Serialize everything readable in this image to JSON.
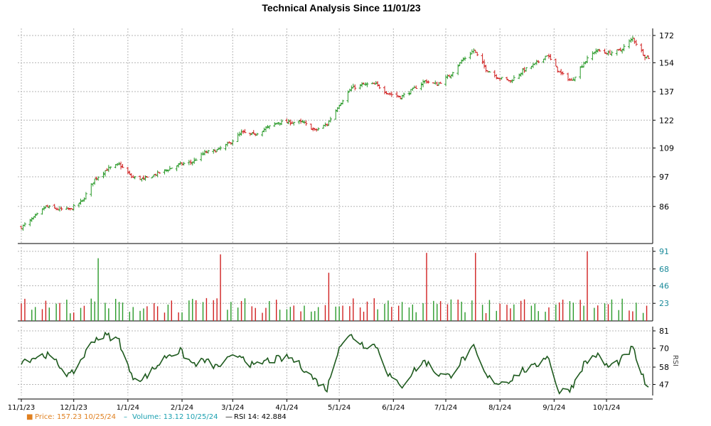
{
  "chart_data": {
    "type": "ohlc-volume-rsi",
    "title": "Technical Analysis Since 11/01/23",
    "x_dates": [
      "11/1/23",
      "12/1/23",
      "1/1/24",
      "2/1/24",
      "3/1/24",
      "4/1/24",
      "5/1/24",
      "6/1/24",
      "7/1/24",
      "8/1/24",
      "9/1/24",
      "10/1/24"
    ],
    "x_range": [
      "11/1/23",
      "10/25/24"
    ],
    "price": {
      "ticks": [
        "172",
        "154",
        "137",
        "122",
        "109",
        "97",
        "86"
      ],
      "ylim": [
        74,
        177
      ],
      "scale": "log",
      "closes_weekly": [
        [
          "11/1/23",
          79
        ],
        [
          "11/8/23",
          82
        ],
        [
          "11/15/23",
          86
        ],
        [
          "11/22/23",
          85
        ],
        [
          "11/29/23",
          85
        ],
        [
          "12/6/23",
          88
        ],
        [
          "12/13/23",
          96
        ],
        [
          "12/20/23",
          100
        ],
        [
          "12/27/23",
          102
        ],
        [
          "1/3/24",
          97
        ],
        [
          "1/10/24",
          96
        ],
        [
          "1/17/24",
          98
        ],
        [
          "1/24/24",
          100
        ],
        [
          "1/31/24",
          102
        ],
        [
          "2/7/24",
          103
        ],
        [
          "2/14/24",
          107
        ],
        [
          "2/21/24",
          108
        ],
        [
          "2/28/24",
          111
        ],
        [
          "3/6/24",
          116
        ],
        [
          "3/13/24",
          115
        ],
        [
          "3/20/24",
          118
        ],
        [
          "3/27/24",
          121
        ],
        [
          "4/3/24",
          121
        ],
        [
          "4/10/24",
          121
        ],
        [
          "4/17/24",
          117
        ],
        [
          "4/24/24",
          120
        ],
        [
          "5/1/24",
          130
        ],
        [
          "5/8/24",
          139
        ],
        [
          "5/15/24",
          141
        ],
        [
          "5/22/24",
          141
        ],
        [
          "5/29/24",
          136
        ],
        [
          "6/5/24",
          134
        ],
        [
          "6/12/24",
          138
        ],
        [
          "6/19/24",
          143
        ],
        [
          "6/26/24",
          141
        ],
        [
          "7/3/24",
          146
        ],
        [
          "7/10/24",
          155
        ],
        [
          "7/17/24",
          162
        ],
        [
          "7/24/24",
          150
        ],
        [
          "7/31/24",
          145
        ],
        [
          "8/7/24",
          143
        ],
        [
          "8/14/24",
          149
        ],
        [
          "8/21/24",
          153
        ],
        [
          "8/28/24",
          159
        ],
        [
          "9/4/24",
          148
        ],
        [
          "9/11/24",
          143
        ],
        [
          "9/18/24",
          154
        ],
        [
          "9/25/24",
          162
        ],
        [
          "10/2/24",
          160
        ],
        [
          "10/9/24",
          162
        ],
        [
          "10/16/24",
          170
        ],
        [
          "10/23/24",
          158
        ],
        [
          "10/25/24",
          157.23
        ]
      ]
    },
    "volume": {
      "ticks": [
        "91",
        "68",
        "46",
        "23"
      ],
      "ylim": [
        0,
        91
      ],
      "spikes": [
        [
          "12/15/23",
          82
        ],
        [
          "2/23/24",
          87
        ],
        [
          "4/26/24",
          63
        ],
        [
          "6/21/24",
          89
        ],
        [
          "7/19/24",
          89
        ],
        [
          "9/20/24",
          91
        ]
      ]
    },
    "rsi": {
      "label": "RSI",
      "ticks": [
        "81",
        "70",
        "58",
        "47"
      ],
      "ylim": [
        40,
        81
      ],
      "weekly": [
        [
          "11/1/23",
          62
        ],
        [
          "11/8/23",
          64
        ],
        [
          "11/15/23",
          66
        ],
        [
          "11/22/23",
          60
        ],
        [
          "11/29/23",
          52
        ],
        [
          "12/6/23",
          64
        ],
        [
          "12/13/23",
          76
        ],
        [
          "12/20/23",
          78
        ],
        [
          "12/27/23",
          75
        ],
        [
          "1/3/24",
          52
        ],
        [
          "1/10/24",
          51
        ],
        [
          "1/17/24",
          58
        ],
        [
          "1/24/24",
          66
        ],
        [
          "1/31/24",
          68
        ],
        [
          "2/7/24",
          60
        ],
        [
          "2/14/24",
          62
        ],
        [
          "2/21/24",
          58
        ],
        [
          "2/28/24",
          63
        ],
        [
          "3/6/24",
          66
        ],
        [
          "3/13/24",
          58
        ],
        [
          "3/20/24",
          62
        ],
        [
          "3/27/24",
          63
        ],
        [
          "4/3/24",
          64
        ],
        [
          "4/10/24",
          58
        ],
        [
          "4/17/24",
          50
        ],
        [
          "4/24/24",
          44
        ],
        [
          "5/1/24",
          72
        ],
        [
          "5/8/24",
          78
        ],
        [
          "5/15/24",
          72
        ],
        [
          "5/22/24",
          72
        ],
        [
          "5/29/24",
          54
        ],
        [
          "6/5/24",
          45
        ],
        [
          "6/12/24",
          55
        ],
        [
          "6/19/24",
          62
        ],
        [
          "6/26/24",
          54
        ],
        [
          "7/3/24",
          52
        ],
        [
          "7/10/24",
          62
        ],
        [
          "7/17/24",
          70
        ],
        [
          "7/24/24",
          52
        ],
        [
          "7/31/24",
          48
        ],
        [
          "8/7/24",
          50
        ],
        [
          "8/14/24",
          56
        ],
        [
          "8/21/24",
          58
        ],
        [
          "8/28/24",
          66
        ],
        [
          "9/4/24",
          42
        ],
        [
          "9/11/24",
          45
        ],
        [
          "9/18/24",
          60
        ],
        [
          "9/25/24",
          66
        ],
        [
          "10/2/24",
          58
        ],
        [
          "10/9/24",
          62
        ],
        [
          "10/16/24",
          70
        ],
        [
          "10/23/24",
          48
        ],
        [
          "10/25/24",
          42.884
        ]
      ]
    },
    "legend": [
      {
        "symbol": "■",
        "text": "Price: 157.23  10/25/24",
        "color": "#e08020"
      },
      {
        "symbol": "–",
        "text": "Volume: 13.12  10/25/24",
        "color": "#1aa0b0"
      },
      {
        "symbol": "—",
        "text": "RSI 14: 42.884",
        "color": "#000000"
      }
    ],
    "colors": {
      "up": "#2a9a2a",
      "down": "#d02020",
      "rsi_line": "#1e5a1e",
      "grid": "#b5b5b5"
    }
  }
}
